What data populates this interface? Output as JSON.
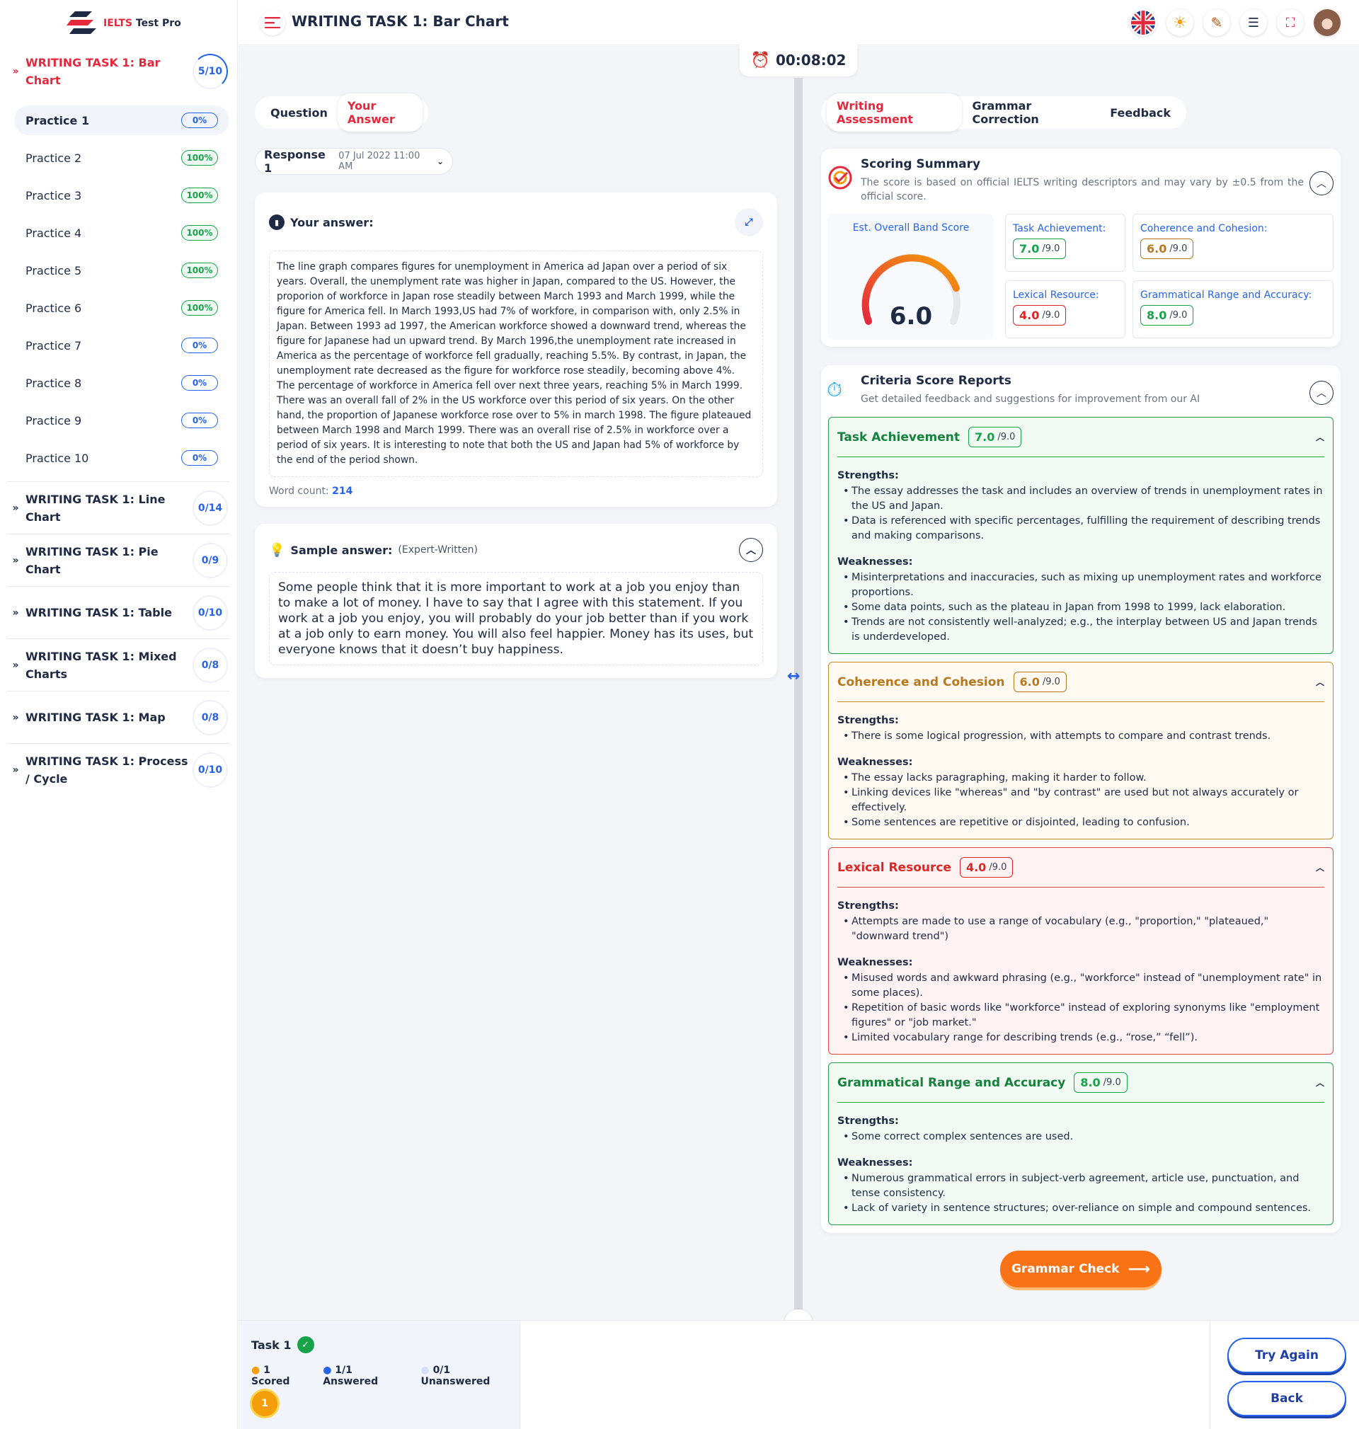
{
  "app": {
    "logo_prefix": "IELTS",
    "logo_suffix": "Test Pro",
    "page_title": "WRITING TASK 1: Bar Chart",
    "timer": "00:08:02"
  },
  "sidebar": {
    "active_group": {
      "title": "WRITING TASK 1: Bar Chart",
      "count": "5/10"
    },
    "practices": [
      {
        "label": "Practice 1",
        "badge": "0%"
      },
      {
        "label": "Practice 2",
        "badge": "100%"
      },
      {
        "label": "Practice 3",
        "badge": "100%"
      },
      {
        "label": "Practice 4",
        "badge": "100%"
      },
      {
        "label": "Practice 5",
        "badge": "100%"
      },
      {
        "label": "Practice 6",
        "badge": "100%"
      },
      {
        "label": "Practice 7",
        "badge": "0%"
      },
      {
        "label": "Practice 8",
        "badge": "0%"
      },
      {
        "label": "Practice 9",
        "badge": "0%"
      },
      {
        "label": "Practice 10",
        "badge": "0%"
      }
    ],
    "groups": [
      {
        "title": "WRITING TASK 1: Line Chart",
        "count": "0/14"
      },
      {
        "title": "WRITING TASK 1: Pie Chart",
        "count": "0/9"
      },
      {
        "title": "WRITING TASK 1: Table",
        "count": "0/10"
      },
      {
        "title": "WRITING TASK 1: Mixed Charts",
        "count": "0/8"
      },
      {
        "title": "WRITING TASK 1: Map",
        "count": "0/8"
      },
      {
        "title": "WRITING TASK 1: Process / Cycle",
        "count": "0/10"
      }
    ]
  },
  "left": {
    "tabs": [
      "Question",
      "Your Answer"
    ],
    "response": {
      "label": "Response 1",
      "date": "07 Jul 2022 11:00 AM"
    },
    "your_answer_title": "Your answer:",
    "answer_text": "The line graph compares figures for unemployment in America ad Japan over a period of six years. Overall, the unemplyment rate was higher in Japan, compared to the US. However, the proporion of workforce in Japan rose steadily between March 1993 and March 1999, while the figure for America fell. In March 1993,US had 7% of workfore, in comparison with, only 2.5% in Japan. Between 1993 ad 1997, the American workforce showed a downward trend, whereas the figure for Japanese had un upward trend. By March 1996,the unemployment rate increased in America as the percentage of workforce fell gradually, reaching 5.5%. By contrast, in Japan, the unemployment rate decreased as the figure for workforce rose steadily, becoming above 4%. The percentage of workforce in America fell over next three years, reaching 5% in March 1999. There was an overall fall of 2% in the US workforce over this period of six years. On the other hand, the proportion of Japanese workforce rose over to 5% in march 1998. The figure plateaued between March 1998 and March 1999. There was an overall rise of 2.5% in workforce over a period of six years. It is interesting to note that both the US and Japan had 5% of workforce by the end of the period shown.",
    "word_count_label": "Word count:",
    "word_count": "214",
    "sample_title": "Sample answer:",
    "sample_note": "(Expert-Written)",
    "sample_text": "Some people think that it is more important to work at a job you enjoy than to make a lot of money. I have to say that I agree with this statement. If you work at a job you enjoy, you will probably do your job better than if you work at a job only to earn money. You will also feel happier. Money has its uses, but everyone knows that it doesn’t buy happiness."
  },
  "right": {
    "tabs": [
      "Writing Assessment",
      "Grammar Correction",
      "Feedback"
    ],
    "summary": {
      "title": "Scoring Summary",
      "desc": "The score is based on official IELTS writing descriptors and may vary by ±0.5 from the official score.",
      "overall_label": "Est. Overall Band Score",
      "overall_score": "6.0",
      "overall_fraction": 0.667,
      "max": "/9.0",
      "tiles": [
        {
          "label": "Task Achievement:",
          "score": "7.0",
          "tone": "g"
        },
        {
          "label": "Coherence and Cohesion:",
          "score": "6.0",
          "tone": "y"
        },
        {
          "label": "Lexical Resource:",
          "score": "4.0",
          "tone": "r"
        },
        {
          "label": "Grammatical Range and Accuracy:",
          "score": "8.0",
          "tone": "g"
        }
      ]
    },
    "criteria_head": {
      "title": "Criteria Score Reports",
      "desc": "Get detailed feedback and suggestions for improvement from our AI"
    },
    "criteria": [
      {
        "title": "Task Achievement",
        "score": "7.0",
        "strengths_label": "Strengths:",
        "weaknesses_label": "Weaknesses:",
        "strengths": [
          "The essay addresses the task and includes an overview of trends in unemployment rates in the US and Japan.",
          "Data is referenced with specific percentages, fulfilling the requirement of describing trends and making comparisons."
        ],
        "weaknesses": [
          "Misinterpretations and inaccuracies, such as mixing up unemployment rates and workforce proportions.",
          "Some data points, such as the plateau in Japan from 1998 to 1999, lack elaboration.",
          "Trends are not consistently well-analyzed; e.g., the interplay between US and Japan trends is underdeveloped."
        ]
      },
      {
        "title": "Coherence and Cohesion",
        "score": "6.0",
        "strengths_label": "Strengths:",
        "weaknesses_label": "Weaknesses:",
        "strengths": [
          "There is some logical progression, with attempts to compare and contrast trends."
        ],
        "weaknesses": [
          "The essay lacks paragraphing, making it harder to follow.",
          "Linking devices like \"whereas\" and \"by contrast\" are used but not always accurately or effectively.",
          "Some sentences are repetitive or disjointed, leading to confusion."
        ]
      },
      {
        "title": "Lexical Resource",
        "score": "4.0",
        "strengths_label": "Strengths:",
        "weaknesses_label": "Weaknesses:",
        "strengths": [
          "Attempts are made to use a range of vocabulary (e.g., \"proportion,\" \"plateaued,\" \"downward trend\")"
        ],
        "weaknesses": [
          "Misused words and awkward phrasing (e.g., \"workforce\" instead of \"unemployment rate\" in some places).",
          "Repetition of basic words like \"workforce\" instead of exploring synonyms like \"employment figures\" or \"job market.\"",
          "Limited vocabulary range for describing trends (e.g., “rose,” “fell”)."
        ]
      },
      {
        "title": "Grammatical Range and Accuracy",
        "score": "8.0",
        "strengths_label": "Strengths:",
        "weaknesses_label": "Weaknesses:",
        "strengths": [
          "Some correct complex sentences are used."
        ],
        "weaknesses": [
          "Numerous grammatical errors in subject-verb agreement, article use, punctuation, and tense consistency.",
          "Lack of variety in sentence structures; over-reliance on simple and compound sentences."
        ]
      }
    ],
    "grammar_check": "Grammar Check"
  },
  "footer": {
    "task": "Task 1",
    "scored": "1 Scored",
    "answered": "1/1 Answered",
    "unanswered": "0/1 Unanswered",
    "coin": "1",
    "try_again": "Try Again",
    "back": "Back"
  },
  "colors": {
    "accent": "#e5283c",
    "blue": "#2563eb",
    "green": "#16a34a",
    "orange": "#f97316"
  }
}
